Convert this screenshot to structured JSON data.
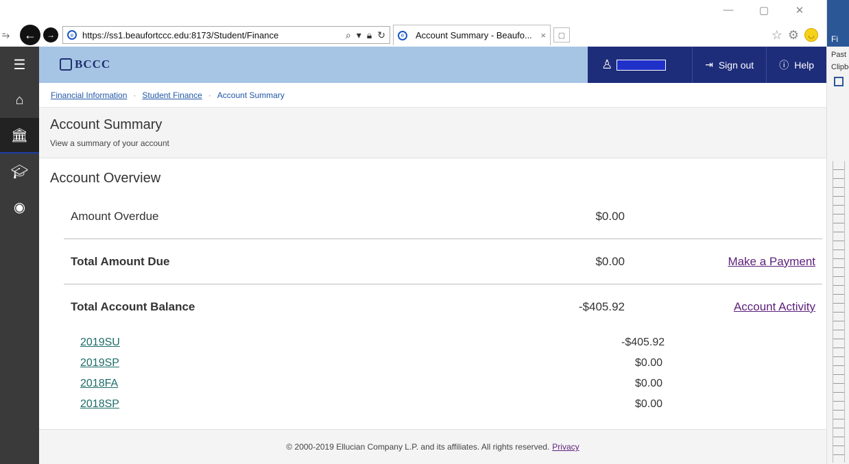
{
  "browser": {
    "url": "https://ss1.beaufortccc.edu:8173/Student/Finance",
    "tab_title": "Account Summary - Beaufo...",
    "tab_close": "×"
  },
  "header": {
    "logo_text": "BCCC",
    "sign_out_label": "Sign out",
    "help_label": "Help"
  },
  "breadcrumb": {
    "items": [
      "Financial Information",
      "Student Finance",
      "Account Summary"
    ]
  },
  "page": {
    "title": "Account Summary",
    "subtitle": "View a summary of your account"
  },
  "overview": {
    "title": "Account Overview",
    "rows": [
      {
        "label": "Amount Overdue",
        "amount": "$0.00",
        "link": ""
      },
      {
        "label": "Total Amount Due",
        "amount": "$0.00",
        "link": "Make a Payment"
      },
      {
        "label": "Total Account Balance",
        "amount": "-$405.92",
        "link": "Account Activity"
      }
    ],
    "terms": [
      {
        "term": "2019SU",
        "amount": "-$405.92"
      },
      {
        "term": "2019SP",
        "amount": "$0.00"
      },
      {
        "term": "2018FA",
        "amount": "$0.00"
      },
      {
        "term": "2018SP",
        "amount": "$0.00"
      }
    ]
  },
  "footer": {
    "copyright": "© 2000-2019 Ellucian Company L.P. and its affiliates. All rights reserved.",
    "privacy_label": "Privacy"
  },
  "office_strip": {
    "tab_label": "Fi",
    "paste_label": "Past",
    "clipboard_label": "Clipbo"
  },
  "colors": {
    "header_bg": "#a6c4e4",
    "header_nav_bg": "#1e2d7a",
    "sidebar_bg": "#3a3a3a",
    "link_purple": "#5b1e7a",
    "term_link": "#1c6c68"
  },
  "icons": {
    "sidebar": [
      "menu-icon",
      "home-icon",
      "finance-bank-icon",
      "graduation-cap-icon",
      "user-circle-icon"
    ]
  }
}
